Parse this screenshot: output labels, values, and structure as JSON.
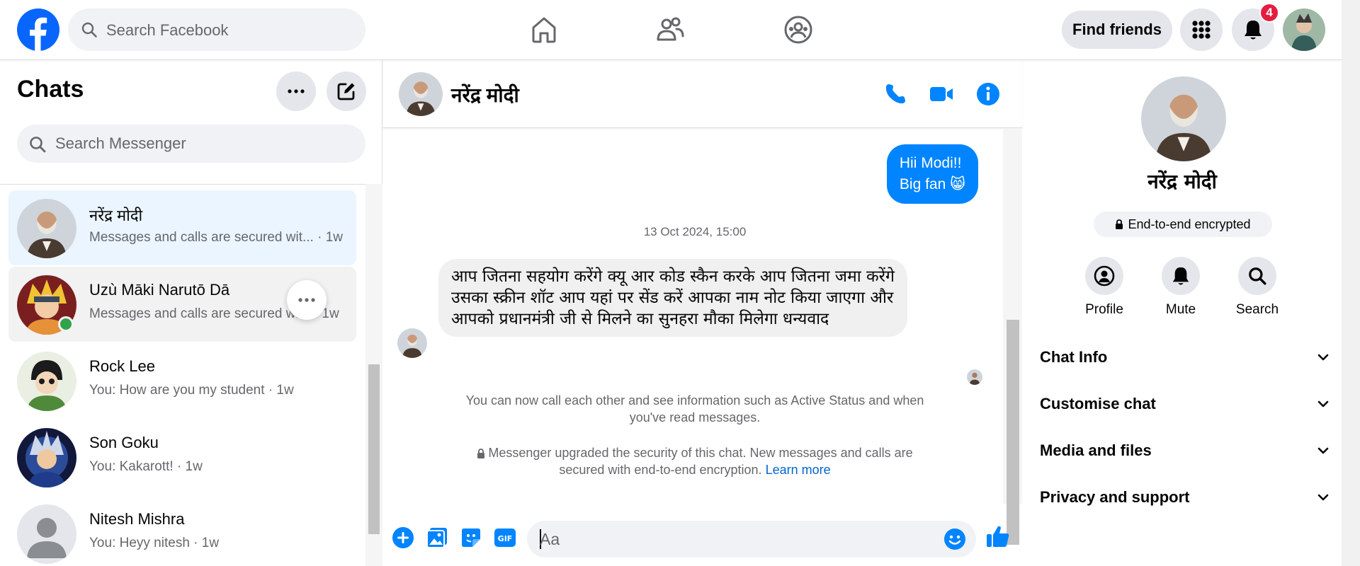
{
  "topbar": {
    "search_placeholder": "Search Facebook",
    "find_friends_label": "Find friends",
    "notification_count": "4"
  },
  "sidebar": {
    "title": "Chats",
    "search_placeholder": "Search Messenger",
    "chats": [
      {
        "name": "नरेंद्र मोदी",
        "preview": "Messages and calls are secured wit... · 1w",
        "state": "active"
      },
      {
        "name": "Uzù Māki Narutō Dā",
        "preview": "Messages and calls are secured wi... · 1w",
        "state": "hover",
        "online": true
      },
      {
        "name": "Rock Lee",
        "preview": "You: How are you my student · 1w"
      },
      {
        "name": "Son Goku",
        "preview": "You: Kakarott! · 1w"
      },
      {
        "name": "Nitesh Mishra",
        "preview": "You: Heyy nitesh · 1w"
      }
    ]
  },
  "conversation": {
    "title": "नरेंद्र मोदी",
    "outgoing_line1": "Hii Modi!!",
    "outgoing_line2": "Big fan 😸",
    "timestamp": "13 Oct 2024, 15:00",
    "incoming_text": "आप जितना सहयोग करेंगे क्यू आर कोड स्कैन करके आप जितना जमा करेंगे उसका स्क्रीन शॉट आप यहां पर सेंड करें आपका नाम नोट किया जाएगा और आपको प्रधानमंत्री जी से मिलने का सुनहरा मौका मिलेगा धन्यवाद",
    "call_notice": "You can now call each other and see information such as Active Status and when you've read messages.",
    "security_notice": "Messenger upgraded the security of this chat. New messages and calls are secured with end-to-end encryption.",
    "learn_more": "Learn more",
    "composer_placeholder": "Aa"
  },
  "info_panel": {
    "name": "नरेंद्र मोदी",
    "encryption_badge": "End-to-end encrypted",
    "actions": [
      "Profile",
      "Mute",
      "Search"
    ],
    "sections": [
      "Chat Info",
      "Customise chat",
      "Media and files",
      "Privacy and support"
    ]
  },
  "colors": {
    "brand_blue": "#0866ff",
    "messenger_blue": "#0084ff",
    "online_green": "#31a24c",
    "badge_red": "#e41e3f"
  }
}
